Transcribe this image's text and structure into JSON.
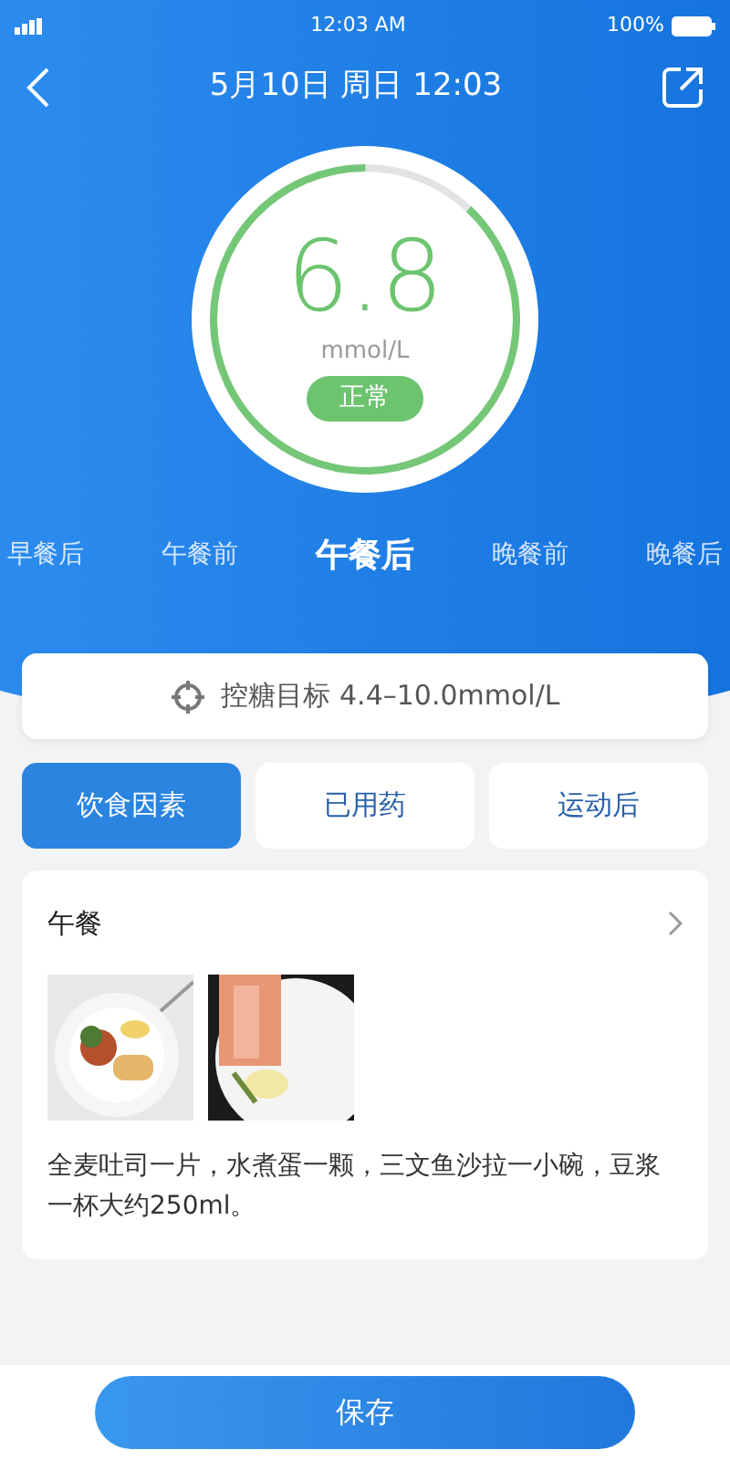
{
  "status_bar": {
    "time": "12:03 AM",
    "battery": "100%"
  },
  "nav": {
    "title": "5月10日 周日 12:03"
  },
  "reading": {
    "value": "6.8",
    "unit": "mmol/L",
    "status": "正常",
    "level": 0.88
  },
  "periods": [
    {
      "label": "早餐后",
      "selected": false
    },
    {
      "label": "午餐前",
      "selected": false
    },
    {
      "label": "午餐后",
      "selected": true
    },
    {
      "label": "晚餐前",
      "selected": false
    },
    {
      "label": "晚餐后",
      "selected": false
    }
  ],
  "target": {
    "text": "控糖目标 4.4–10.0mmol/L"
  },
  "factors": [
    {
      "label": "饮食因素",
      "selected": true
    },
    {
      "label": "已用药",
      "selected": false
    },
    {
      "label": "运动后",
      "selected": false
    }
  ],
  "meal": {
    "title": "午餐",
    "description": "全麦吐司一片，水煮蛋一颗，三文鱼沙拉一小碗，豆浆一杯大约250ml。"
  },
  "save_button": "保存"
}
